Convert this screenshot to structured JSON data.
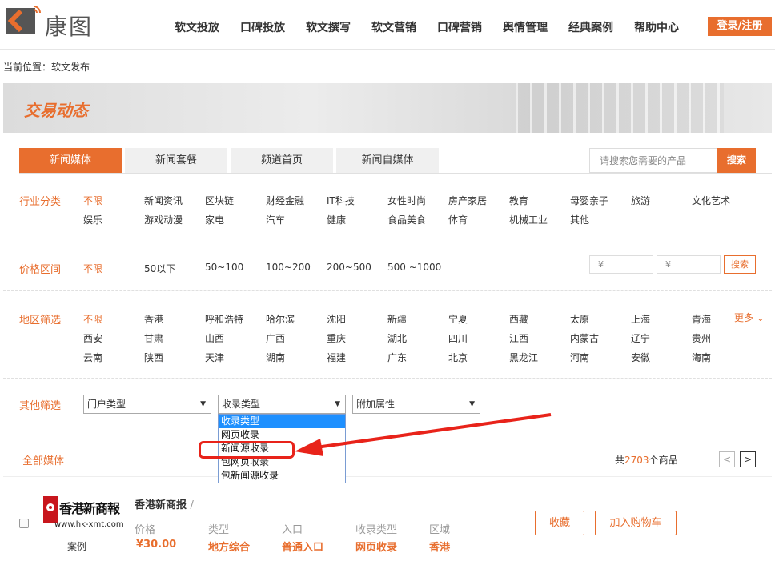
{
  "brand": {
    "name": "康图",
    "accent": "#e86e2e"
  },
  "nav": {
    "items": [
      "软文投放",
      "口碑投放",
      "软文撰写",
      "软文营销",
      "口碑营销",
      "舆情管理",
      "经典案例",
      "帮助中心"
    ],
    "login": "登录/注册"
  },
  "breadcrumb": "当前位置：软文发布",
  "banner": {
    "title": "交易动态"
  },
  "tabs": [
    "新闻媒体",
    "新闻套餐",
    "频道首页",
    "新闻自媒体"
  ],
  "search": {
    "placeholder": "请搜索您需要的产品",
    "button": "搜索"
  },
  "filters": {
    "industry": {
      "label": "行业分类",
      "row1": [
        "不限",
        "新闻资讯",
        "区块链",
        "财经金融",
        "IT科技",
        "女性时尚",
        "房产家居",
        "教育",
        "母婴亲子",
        "旅游",
        "文化艺术"
      ],
      "row2": [
        "娱乐",
        "游戏动漫",
        "家电",
        "汽车",
        "健康",
        "食品美食",
        "体育",
        "机械工业",
        "其他"
      ]
    },
    "price": {
      "label": "价格区间",
      "options": [
        "不限",
        "50以下",
        "50~100",
        "100~200",
        "200~500",
        "500 ~1000"
      ],
      "min_placeholder": "¥",
      "max_placeholder": "¥",
      "button": "搜索"
    },
    "region": {
      "label": "地区筛选",
      "row1": [
        "不限",
        "香港",
        "呼和浩特",
        "哈尔滨",
        "沈阳",
        "新疆",
        "宁夏",
        "西藏",
        "太原",
        "上海",
        "青海"
      ],
      "row2": [
        "西安",
        "甘肃",
        "山西",
        "广西",
        "重庆",
        "湖北",
        "四川",
        "江西",
        "内蒙古",
        "辽宁",
        "贵州"
      ],
      "row3": [
        "云南",
        "陕西",
        "天津",
        "湖南",
        "福建",
        "广东",
        "北京",
        "黑龙江",
        "河南",
        "安徽",
        "海南"
      ],
      "more": "更多 ⌄"
    },
    "other": {
      "label": "其他筛选",
      "portal_type": "门户类型",
      "index_type": "收录类型",
      "extra": "附加属性",
      "dropdown": [
        "收录类型",
        "网页收录",
        "新闻源收录",
        "包网页收录",
        "包新闻源收录"
      ]
    }
  },
  "list": {
    "all_label": "全部媒体",
    "count_prefix": "共",
    "count": "2703",
    "count_suffix": "个商品",
    "prev": "<",
    "next": ">"
  },
  "item": {
    "logo_text": "香港新商報",
    "logo_url": "www.hk-xmt.com",
    "case_label": "案例",
    "name": "香港新商报",
    "slash": "/",
    "keys": [
      "价格",
      "类型",
      "入口",
      "收录类型",
      "区域"
    ],
    "values": [
      "¥30.00",
      "地方综合",
      "普通入口",
      "网页收录",
      "香港"
    ],
    "favorite": "收藏",
    "add_cart": "加入购物车"
  }
}
